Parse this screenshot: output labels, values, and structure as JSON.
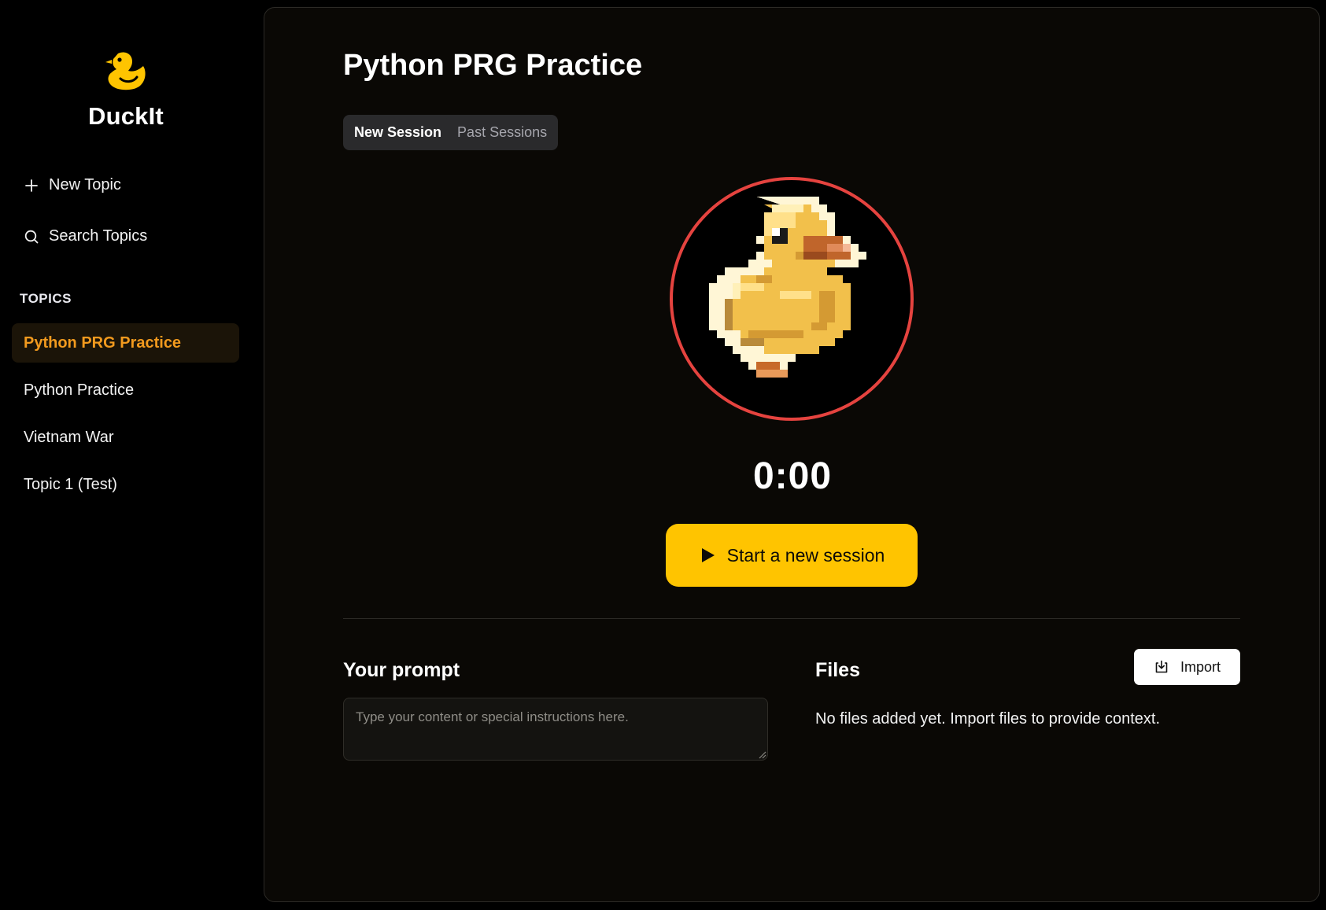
{
  "brand": {
    "name": "DuckIt",
    "logo_icon": "duck-logo-icon",
    "accent": "#ffc400"
  },
  "sidebar": {
    "new_topic_label": "New Topic",
    "search_topics_label": "Search Topics",
    "topics_heading": "TOPICS",
    "items": [
      {
        "label": "Python PRG Practice",
        "active": true
      },
      {
        "label": "Python Practice",
        "active": false
      },
      {
        "label": "Vietnam War",
        "active": false
      },
      {
        "label": "Topic 1 (Test)",
        "active": false
      }
    ],
    "active_color": "#f29a1e"
  },
  "main": {
    "title": "Python PRG Practice",
    "tabs": [
      {
        "label": "New Session",
        "active": true
      },
      {
        "label": "Past Sessions",
        "active": false
      }
    ],
    "avatar_icon": "pixel-duck-icon",
    "ring_color": "#e5433f",
    "timer": "0:00",
    "start_button_label": "Start a new session",
    "prompt": {
      "title": "Your prompt",
      "placeholder": "Type your content or special instructions here.",
      "value": ""
    },
    "files": {
      "title": "Files",
      "import_label": "Import",
      "empty_text": "No files added yet. Import files to provide context."
    }
  }
}
